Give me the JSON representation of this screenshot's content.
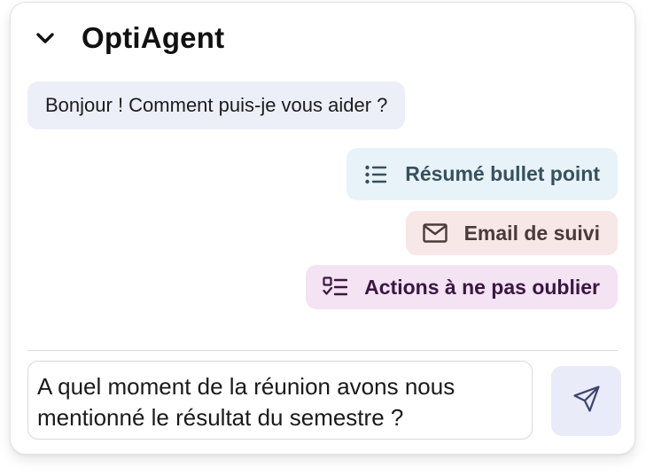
{
  "header": {
    "title": "OptiAgent",
    "collapse_icon": "chevron-down-icon"
  },
  "messages": [
    {
      "role": "assistant",
      "text": "Bonjour ! Comment puis-je vous aider ?"
    }
  ],
  "suggestions": [
    {
      "label": "Résumé bullet point",
      "icon": "bulleted-list-icon"
    },
    {
      "label": "Email de suivi",
      "icon": "mail-icon"
    },
    {
      "label": "Actions à ne pas oublier",
      "icon": "checklist-icon"
    }
  ],
  "composer": {
    "value": "A quel moment de la réunion avons nous mentionné le résultat du semestre ?",
    "send_icon": "send-icon"
  },
  "colors": {
    "greeting_bg": "#eceef8",
    "summary_bg": "#e8f3f9",
    "email_bg": "#f7e7e6",
    "actions_bg": "#f4e3f2",
    "send_bg": "#e9ebf8"
  }
}
